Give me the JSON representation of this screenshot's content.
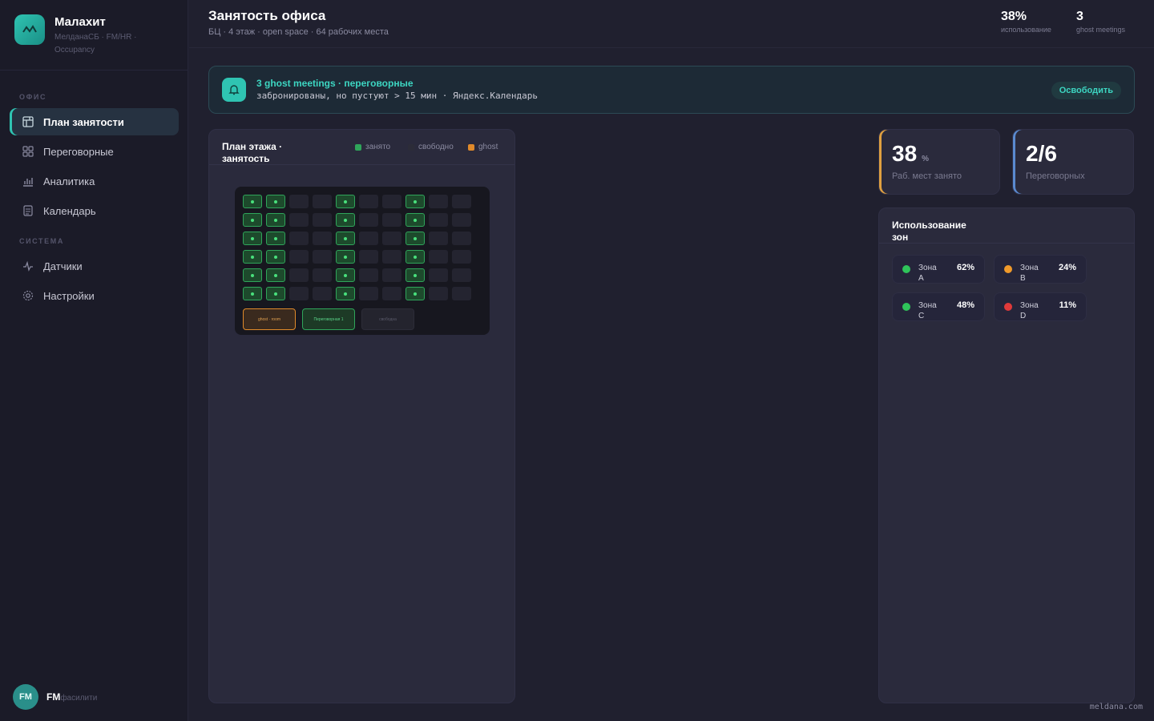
{
  "brand": {
    "name": "Малахит",
    "subtitle": "МелданаСБ · FM/HR · Occupancy",
    "logo_icon": "wave-icon"
  },
  "sidebar": {
    "sections": [
      {
        "label": "ОФИС"
      },
      {
        "label": "СИСТЕМА"
      }
    ],
    "items": [
      {
        "label": "План занятости",
        "icon": "floor-plan-icon",
        "active": true
      },
      {
        "label": "Переговорные",
        "icon": "rooms-icon"
      },
      {
        "label": "Аналитика",
        "icon": "chart-icon"
      },
      {
        "label": "Календарь",
        "icon": "calendar-icon"
      },
      {
        "label": "Датчики",
        "icon": "pulse-icon"
      },
      {
        "label": "Настройки",
        "icon": "gear-icon"
      }
    ]
  },
  "user": {
    "initials": "FM",
    "name": "FM",
    "role": "фасилити"
  },
  "header": {
    "title": "Занятость офиса",
    "subtitle": "БЦ · 4 этаж · open space · 64 рабочих места",
    "stats": [
      {
        "value": "38%",
        "label": "использование"
      },
      {
        "value": "3",
        "label": "ghost meetings"
      }
    ]
  },
  "alert": {
    "title": "3 ghost meetings · переговорные",
    "text": "забронированы, но пустуют > 15 мин · Яндекс.Календарь",
    "button": "Освободить",
    "icon": "bell-icon"
  },
  "floor_panel": {
    "title": "План этажа · занятость",
    "legend": [
      {
        "label": "занято",
        "color": "#2fa55a"
      },
      {
        "label": "свободно",
        "color": "#2c2c38"
      },
      {
        "label": "ghost",
        "color": "#e08a2a"
      }
    ],
    "rooms": [
      {
        "label": "ghost · room",
        "state": "ghost"
      },
      {
        "label": "Переговорная 1",
        "state": "busy"
      },
      {
        "label": "свободна",
        "state": "free"
      }
    ]
  },
  "kpis": [
    {
      "value": "38",
      "unit": "%",
      "label": "Раб. мест занято",
      "accent": "#e0a040"
    },
    {
      "value": "2/6",
      "unit": "",
      "label": "Переговорных",
      "accent": "#5a8ad0"
    }
  ],
  "zones_panel": {
    "title": "Использование зон",
    "zones": [
      {
        "name": "Зона A",
        "pct": "62%",
        "color": "#2fc45a"
      },
      {
        "name": "Зона B",
        "pct": "24%",
        "color": "#f09a2a"
      },
      {
        "name": "Зона C",
        "pct": "48%",
        "color": "#2fc45a"
      },
      {
        "name": "Зона D",
        "pct": "11%",
        "color": "#e03a3a"
      }
    ]
  },
  "footer": {
    "watermark": "meldana.com"
  }
}
